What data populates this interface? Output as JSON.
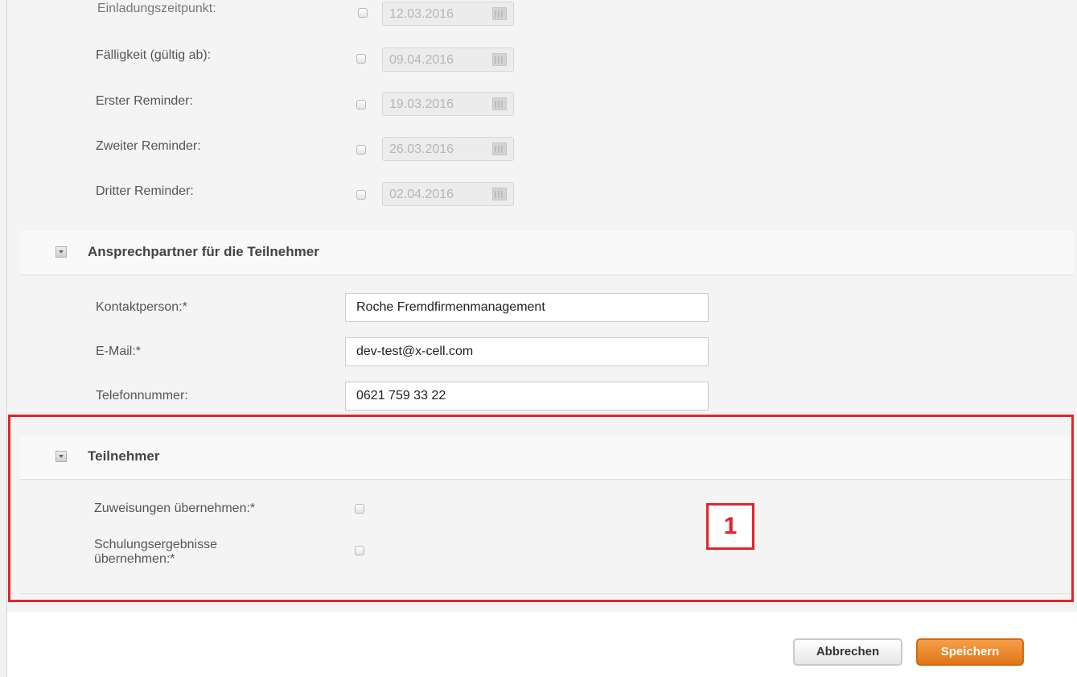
{
  "dates": [
    {
      "label": "Einladungszeitpunkt:",
      "value": "12.03.2016"
    },
    {
      "label": "Fälligkeit (gültig ab):",
      "value": "09.04.2016"
    },
    {
      "label": "Erster Reminder:",
      "value": "19.03.2016"
    },
    {
      "label": "Zweiter Reminder:",
      "value": "26.03.2016"
    },
    {
      "label": "Dritter Reminder:",
      "value": "02.04.2016"
    }
  ],
  "contact_section": {
    "title": "Ansprechpartner für die Teilnehmer",
    "kontakt_label": "Kontaktperson:*",
    "kontakt_value": "Roche Fremdfirmenmanagement",
    "email_label": "E-Mail:*",
    "email_value": "dev-test@x-cell.com",
    "telefon_label": "Telefonnummer:",
    "telefon_value": "0621 759 33 22"
  },
  "participants_section": {
    "title": "Teilnehmer",
    "zuweisungen_label": "Zuweisungen übernehmen:*",
    "schulung_label_line1": "Schulungsergebnisse",
    "schulung_label_line2": "übernehmen:*"
  },
  "annotation": {
    "number": "1",
    "color": "#e3242b"
  },
  "buttons": {
    "cancel_label": "Abbrechen",
    "save_label": "Speichern",
    "save_color": "#e98a2a"
  }
}
